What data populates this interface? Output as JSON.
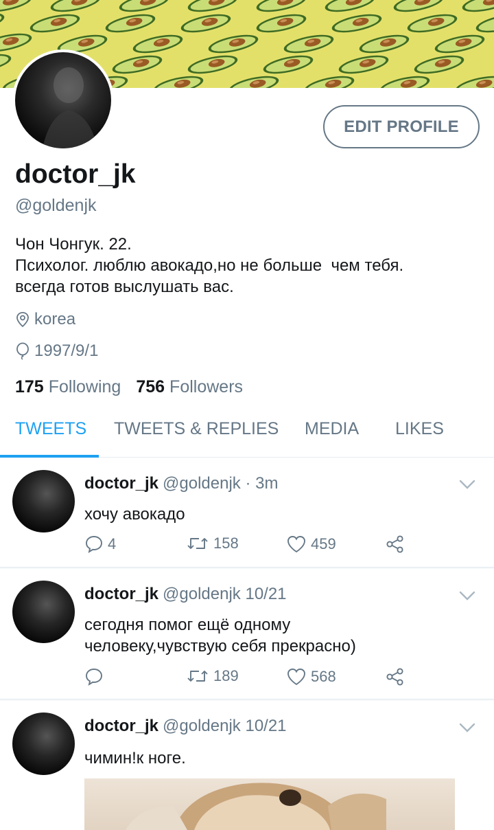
{
  "profile": {
    "display_name": "doctor_jk",
    "handle": "@goldenjk",
    "edit_label": "EDIT PROFILE",
    "bio": [
      "Чон Чонгук. 22.",
      "Психолог. люблю авокадо,но не больше  чем тебя.",
      "всегда готов выслушать вас."
    ],
    "location": "korea",
    "birthday": "1997/9/1",
    "following_count": "175",
    "following_label": "Following",
    "followers_count": "756",
    "followers_label": "Followers"
  },
  "tabs": [
    {
      "label": "TWEETS",
      "active": true
    },
    {
      "label": "TWEETS & REPLIES",
      "active": false
    },
    {
      "label": "MEDIA",
      "active": false
    },
    {
      "label": "LIKES",
      "active": false
    }
  ],
  "tweets": [
    {
      "name": "doctor_jk",
      "handle": "@goldenjk",
      "time": "· 3m",
      "text": [
        "хочу авокадо"
      ],
      "replies": "4",
      "retweets": "158",
      "likes": "459"
    },
    {
      "name": "doctor_jk",
      "handle": "@goldenjk",
      "time": "10/21",
      "text": [
        "сегодня помог ещё одному",
        "человеку,чувствую себя прекрасно)"
      ],
      "replies": "",
      "retweets": "189",
      "likes": "568"
    },
    {
      "name": "doctor_jk",
      "handle": "@goldenjk",
      "time": "10/21",
      "text": [
        "чимин!к ноге."
      ]
    }
  ],
  "colors": {
    "accent": "#1da1f2",
    "muted": "#657786",
    "banner": "#e3e06a"
  },
  "icons": [
    "location-icon",
    "balloon-icon",
    "reply-icon",
    "retweet-icon",
    "like-icon",
    "share-icon",
    "chevron-down-icon"
  ]
}
